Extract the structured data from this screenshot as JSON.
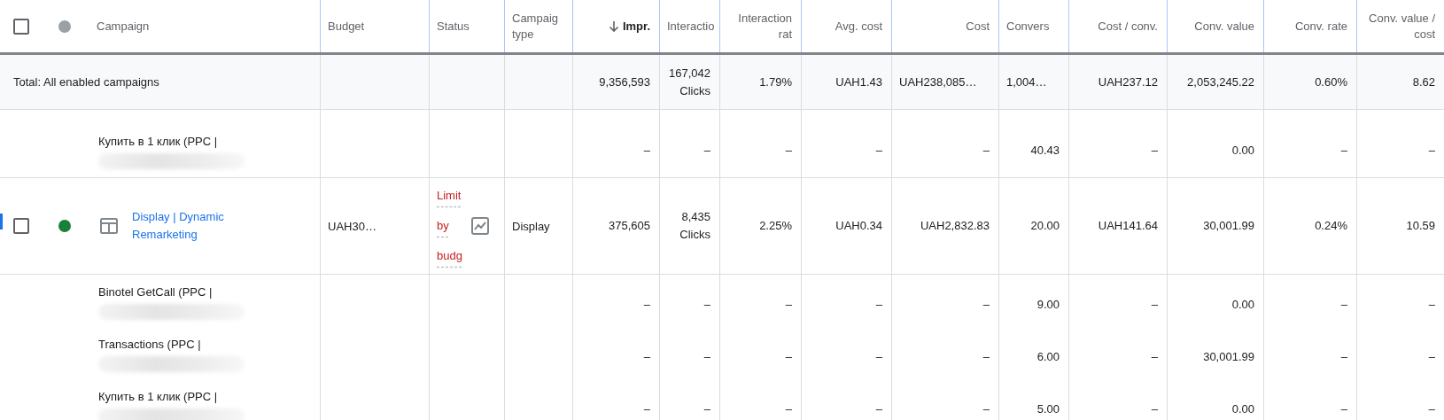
{
  "table": {
    "header": {
      "checkbox": {
        "checked": false
      },
      "columns": [
        {
          "label": "Campaign",
          "sorted": false
        },
        {
          "label": "Budget",
          "sorted": false
        },
        {
          "label": "Status",
          "sorted": false
        },
        {
          "label": "Campaig type",
          "sorted": false
        },
        {
          "label": "Impr.",
          "sorted": true
        },
        {
          "label": "Interactio",
          "sorted": false
        },
        {
          "label": "Interaction rat",
          "sorted": false
        },
        {
          "label": "Avg. cost",
          "sorted": false
        },
        {
          "label": "Cost",
          "sorted": false
        },
        {
          "label": "Convers",
          "sorted": false
        },
        {
          "label": "Cost / conv.",
          "sorted": false
        },
        {
          "label": "Conv. value",
          "sorted": false
        },
        {
          "label": "Conv. rate",
          "sorted": false
        },
        {
          "label": "Conv. value / cost",
          "sorted": false
        }
      ]
    },
    "total": {
      "label": "Total: All enabled campaigns",
      "metrics": [
        {
          "value": "9,356,593"
        },
        {
          "value": "167,042",
          "sub": "Clicks"
        },
        {
          "value": "1.79%"
        },
        {
          "value": "UAH1.43"
        },
        {
          "value": "UAH238,085…"
        },
        {
          "value": "1,004…"
        },
        {
          "value": "UAH237.12"
        },
        {
          "value": "2,053,245.22"
        },
        {
          "value": "0.60%"
        },
        {
          "value": "8.62"
        }
      ]
    },
    "rows": [
      {
        "kind": "segments",
        "items": [
          {
            "name": "Купить в 1 клик (PPC |",
            "metrics": [
              "–",
              "–",
              "–",
              "–",
              "–",
              "40.43",
              "–",
              "0.00",
              "–",
              "–"
            ]
          }
        ]
      },
      {
        "kind": "campaign",
        "selected": true,
        "checkbox": {
          "checked": false
        },
        "color": "#188038",
        "name": "Display | Dynamic Remarketing",
        "budget": "UAH30…",
        "status": "Limit by budg",
        "type": "Display",
        "metrics": [
          {
            "value": "375,605"
          },
          {
            "value": "8,435",
            "sub": "Clicks"
          },
          {
            "value": "2.25%"
          },
          {
            "value": "UAH0.34"
          },
          {
            "value": "UAH2,832.83"
          },
          {
            "value": "20.00"
          },
          {
            "value": "UAH141.64"
          },
          {
            "value": "30,001.99"
          },
          {
            "value": "0.24%"
          },
          {
            "value": "10.59"
          }
        ]
      },
      {
        "kind": "segments",
        "items": [
          {
            "name": "Binotel GetCall (PPC |",
            "metrics": [
              "–",
              "–",
              "–",
              "–",
              "–",
              "9.00",
              "–",
              "0.00",
              "–",
              "–"
            ]
          },
          {
            "name": "Transactions (PPC |",
            "metrics": [
              "–",
              "–",
              "–",
              "–",
              "–",
              "6.00",
              "–",
              "30,001.99",
              "–",
              "–"
            ]
          },
          {
            "name": "Купить в 1 клик (PPC |",
            "metrics": [
              "–",
              "–",
              "–",
              "–",
              "–",
              "5.00",
              "–",
              "0.00",
              "–",
              "–"
            ]
          }
        ]
      }
    ]
  }
}
